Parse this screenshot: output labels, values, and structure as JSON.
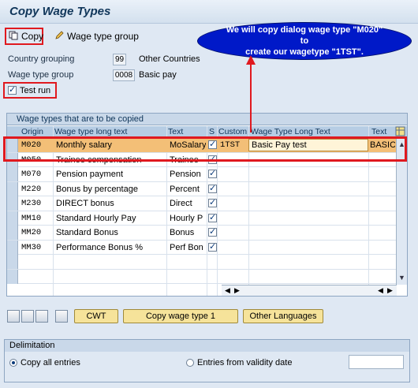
{
  "window": {
    "title": "Copy Wage Types"
  },
  "toolbar": {
    "copy_label": "Copy",
    "wage_type_group_label": "Wage type group"
  },
  "callout": {
    "text": "We will copy dialog wage type \"M020\" to\ncreate our wagetype \"1TST\"."
  },
  "form": {
    "country_grouping_label": "Country grouping",
    "country_grouping_value": "99",
    "country_grouping_text": "Other Countries",
    "wage_type_group_label": "Wage type group",
    "wage_type_group_value": "0008",
    "wage_type_group_text": "Basic pay",
    "test_run_label": "Test run",
    "test_run_checked": true
  },
  "table": {
    "title": "Wage types that are to be copied",
    "headers": [
      "Origin",
      "Wage type long text",
      "Text",
      "S",
      "Custom",
      "Wage Type Long Text",
      "Text"
    ],
    "rows": [
      {
        "origin": "M020",
        "long_text": "Monthly salary",
        "text": "MoSalary",
        "checked": true,
        "custom": "1TST",
        "custom_long": "Basic Pay test",
        "custom_text": "BASIC"
      },
      {
        "origin": "M050",
        "long_text": "Trainee compensation",
        "text": "Trainee",
        "checked": true,
        "custom": "",
        "custom_long": "",
        "custom_text": ""
      },
      {
        "origin": "M070",
        "long_text": "Pension payment",
        "text": "Pension",
        "checked": true,
        "custom": "",
        "custom_long": "",
        "custom_text": ""
      },
      {
        "origin": "M220",
        "long_text": "Bonus by percentage",
        "text": "Percent",
        "checked": true,
        "custom": "",
        "custom_long": "",
        "custom_text": ""
      },
      {
        "origin": "M230",
        "long_text": "DIRECT bonus",
        "text": "Direct",
        "checked": true,
        "custom": "",
        "custom_long": "",
        "custom_text": ""
      },
      {
        "origin": "MM10",
        "long_text": "Standard Hourly Pay",
        "text": "Hourly P",
        "checked": true,
        "custom": "",
        "custom_long": "",
        "custom_text": ""
      },
      {
        "origin": "MM20",
        "long_text": "Standard Bonus",
        "text": "Bonus",
        "checked": true,
        "custom": "",
        "custom_long": "",
        "custom_text": ""
      },
      {
        "origin": "MM30",
        "long_text": "Performance Bonus %",
        "text": "Perf Bon",
        "checked": true,
        "custom": "",
        "custom_long": "",
        "custom_text": ""
      },
      {
        "origin": "",
        "long_text": "",
        "text": "",
        "checked": false,
        "custom": "",
        "custom_long": "",
        "custom_text": ""
      },
      {
        "origin": "",
        "long_text": "",
        "text": "",
        "checked": false,
        "custom": "",
        "custom_long": "",
        "custom_text": ""
      }
    ]
  },
  "buttons": {
    "cwt": "CWT",
    "copy_wage_type": "Copy wage type 1",
    "other_languages": "Other Languages"
  },
  "delimitation": {
    "title": "Delimitation",
    "copy_all": "Copy all entries",
    "from_validity": "Entries from validity date"
  },
  "colors": {
    "highlight_red": "#e0191f",
    "callout_blue": "#0019c8",
    "selected_row": "#f3bf77"
  }
}
